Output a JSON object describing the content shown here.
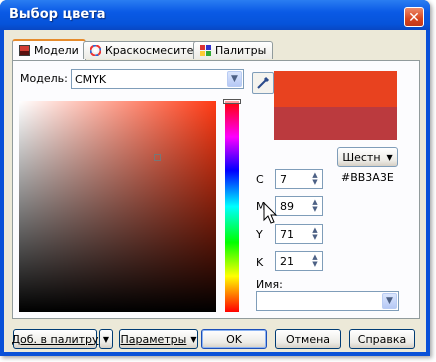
{
  "window": {
    "title": "Выбор цвета",
    "close_glyph": "✕"
  },
  "tabs": [
    {
      "label": "Модели",
      "icon": "color-models-icon",
      "active": true
    },
    {
      "label": "Краскосмесители",
      "icon": "color-wheel-icon",
      "active": false
    },
    {
      "label": "Палитры",
      "icon": "palette-grid-icon",
      "active": false
    }
  ],
  "model": {
    "label": "Модель:",
    "value": "CMYK"
  },
  "swatches": {
    "new_color": "#e8421f",
    "old_color": "#bb3a3e"
  },
  "format": {
    "label": "Шестн",
    "hex_value": "#BB3A3E"
  },
  "cmyk": [
    {
      "label": "C",
      "value": "7"
    },
    {
      "label": "M",
      "value": "89"
    },
    {
      "label": "Y",
      "value": "71"
    },
    {
      "label": "K",
      "value": "21"
    }
  ],
  "name": {
    "label": "Имя:",
    "value": ""
  },
  "buttons": {
    "add_to_palette": "Доб. в палитру",
    "parameters": "Параметры",
    "ok": "OK",
    "cancel": "Отмена",
    "help": "Справка"
  },
  "colors": {
    "titlebar": "#0a5ae6",
    "dialog_bg": "#ece9d8",
    "accent_tab": "#e68b2c"
  }
}
